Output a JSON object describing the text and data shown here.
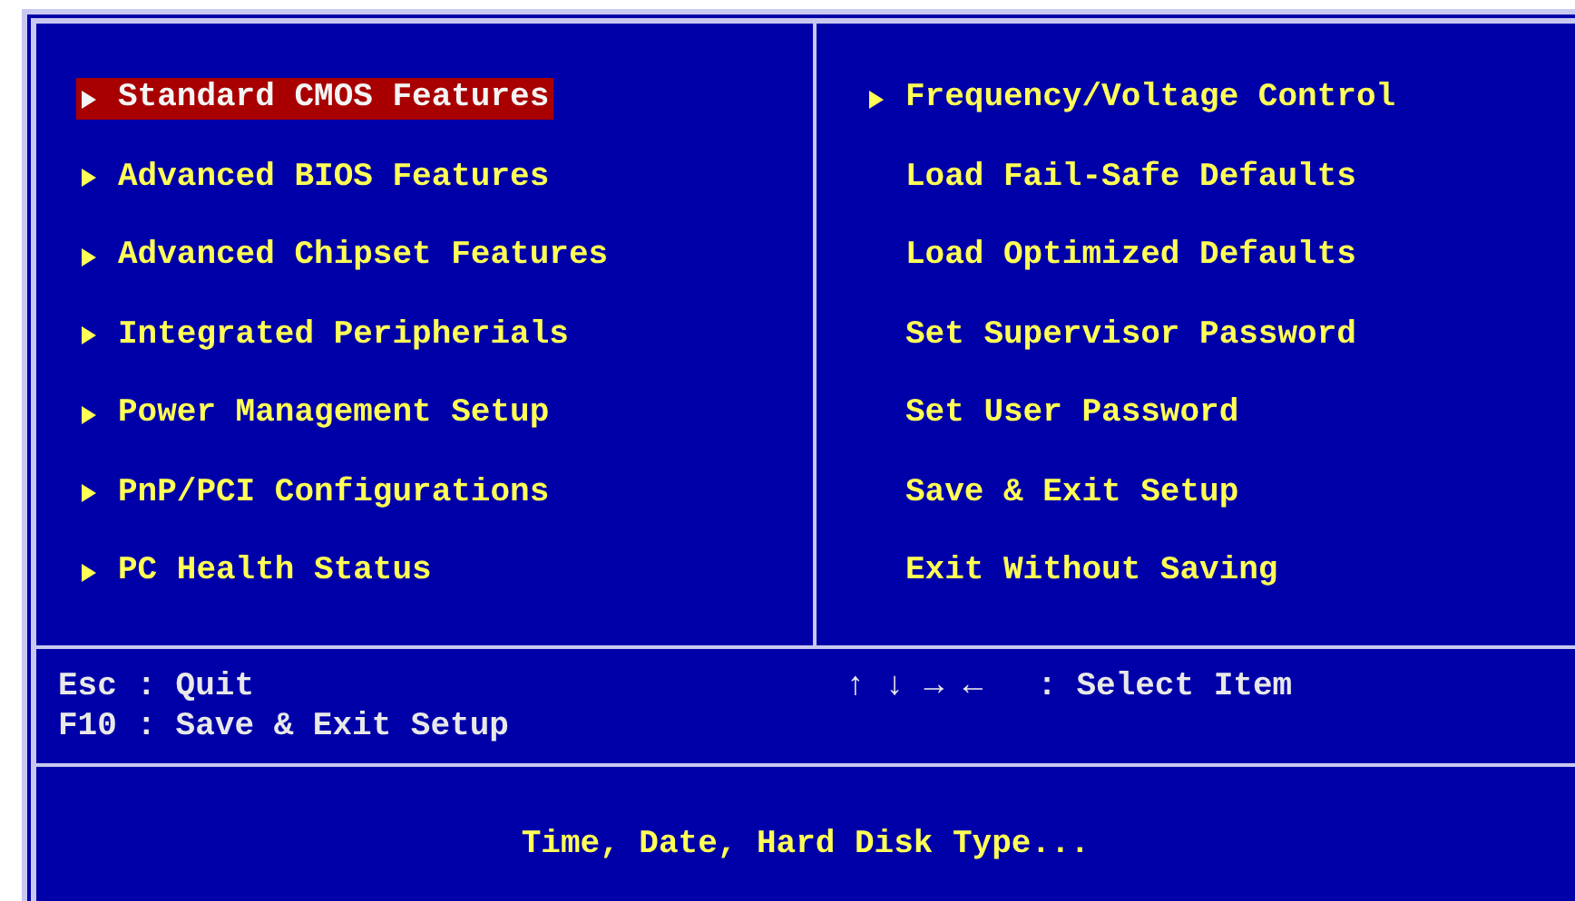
{
  "menu_left": [
    {
      "label": "Standard CMOS Features",
      "arrow": true,
      "selected": true
    },
    {
      "label": "Advanced BIOS Features",
      "arrow": true,
      "selected": false
    },
    {
      "label": "Advanced Chipset Features",
      "arrow": true,
      "selected": false
    },
    {
      "label": "Integrated Peripherials",
      "arrow": true,
      "selected": false
    },
    {
      "label": "Power Management Setup",
      "arrow": true,
      "selected": false
    },
    {
      "label": "PnP/PCI Configurations",
      "arrow": true,
      "selected": false
    },
    {
      "label": "PC Health Status",
      "arrow": true,
      "selected": false
    }
  ],
  "menu_right": [
    {
      "label": "Frequency/Voltage Control",
      "arrow": true,
      "selected": false
    },
    {
      "label": "Load Fail-Safe Defaults",
      "arrow": false,
      "selected": false
    },
    {
      "label": "Load Optimized Defaults",
      "arrow": false,
      "selected": false
    },
    {
      "label": "Set Supervisor Password",
      "arrow": false,
      "selected": false
    },
    {
      "label": "Set User Password",
      "arrow": false,
      "selected": false
    },
    {
      "label": "Save & Exit Setup",
      "arrow": false,
      "selected": false
    },
    {
      "label": "Exit Without Saving",
      "arrow": false,
      "selected": false
    }
  ],
  "help": {
    "left": [
      "Esc : Quit",
      "F10 : Save & Exit Setup"
    ],
    "keys": "↑ ↓ → ←",
    "action": ": Select Item"
  },
  "description": "Time, Date, Hard Disk Type..."
}
